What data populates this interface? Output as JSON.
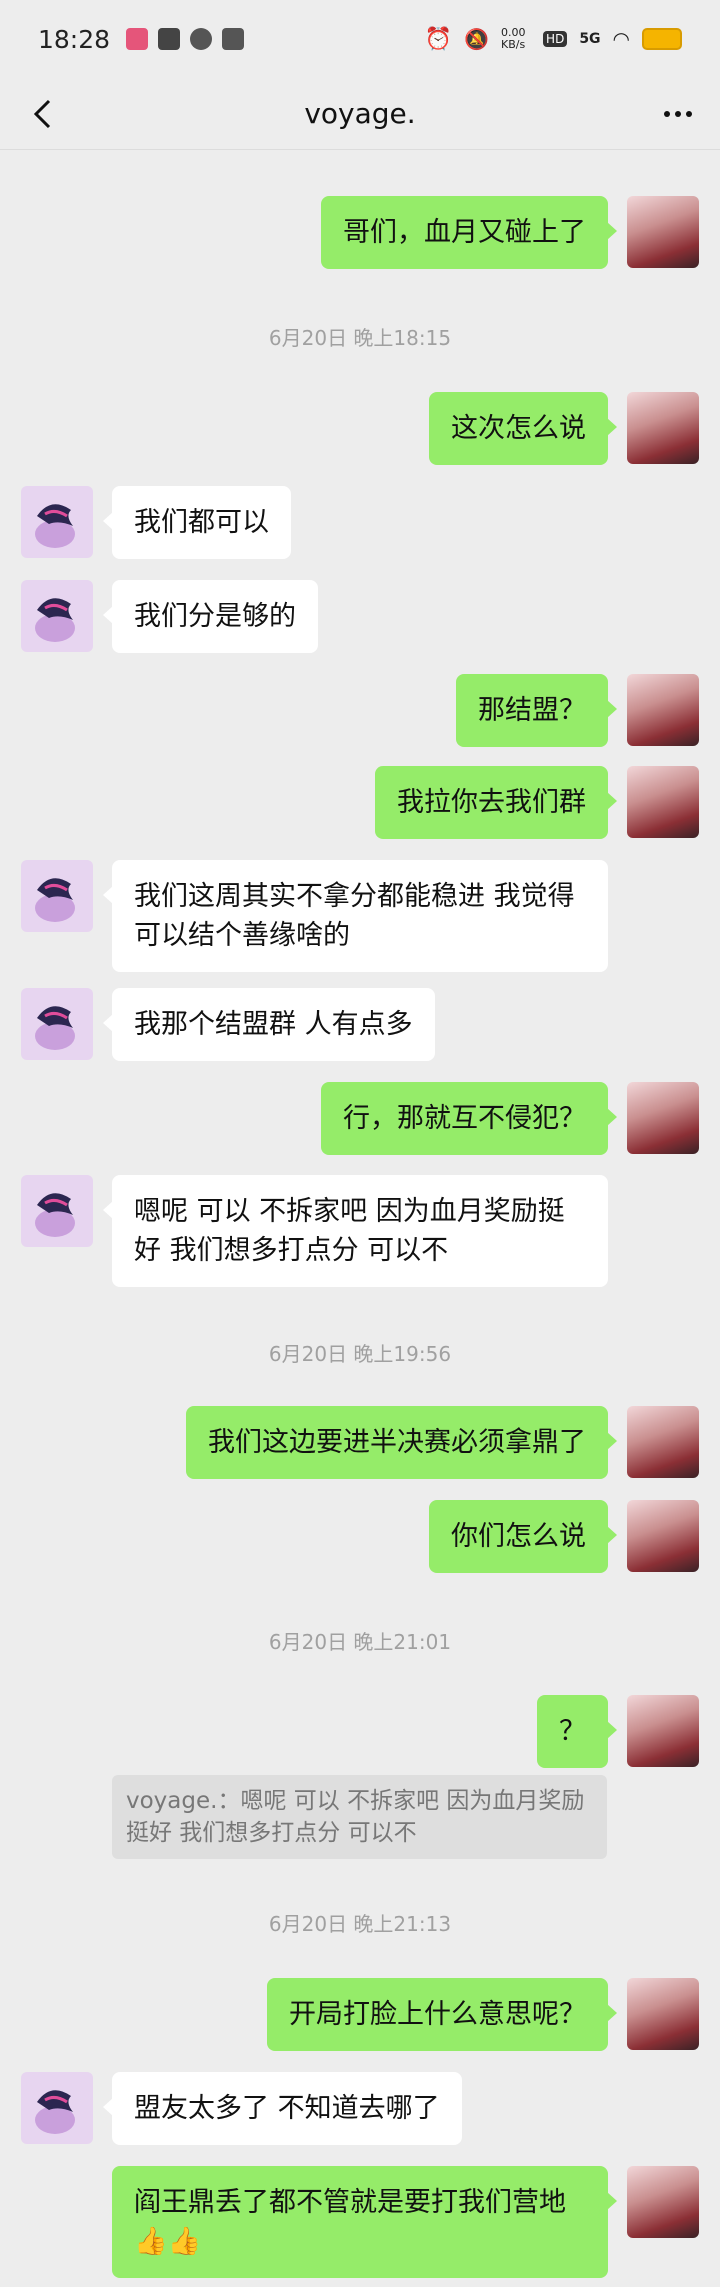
{
  "status_bar": {
    "time": "18:28",
    "net_speed": "0.00\nKB/s",
    "signal_label": "5G",
    "hd_label": "HD"
  },
  "nav": {
    "title": "voyage."
  },
  "timestamps": [
    "6月20日 晚上18:15",
    "6月20日 晚上19:56",
    "6月20日 晚上21:01",
    "6月20日 晚上21:13"
  ],
  "messages": [
    "哥们，血月又碰上了",
    "这次怎么说",
    "我们都可以",
    "我们分是够的",
    "那结盟？",
    "我拉你去我们群",
    "我们这周其实不拿分都能稳进 我觉得可以结个善缘啥的",
    "我那个结盟群 人有点多",
    "行，那就互不侵犯？",
    "嗯呢 可以 不拆家吧 因为血月奖励挺好 我们想多打点分 可以不",
    "我们这边要进半决赛必须拿鼎了",
    "你们怎么说",
    "？",
    "开局打脸上什么意思呢？",
    "盟友太多了 不知道去哪了",
    "阎王鼎丢了都不管就是要打我们营地👍👍"
  ],
  "quote": {
    "text": "voyage.：嗯呢 可以 不拆家吧 因为血月奖励挺好 我们想多打点分 可以不"
  },
  "colors": {
    "background": "#ededed",
    "bubble_me": "#95ec69",
    "bubble_other": "#ffffff"
  }
}
